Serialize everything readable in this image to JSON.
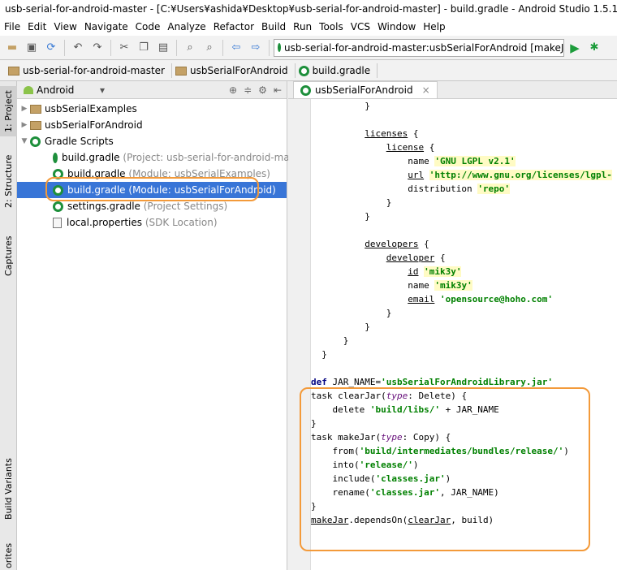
{
  "window": {
    "title": "usb-serial-for-android-master - [C:¥Users¥ashida¥Desktop¥usb-serial-for-android-master] - build.gradle - Android Studio 1.5.1"
  },
  "menu": [
    "File",
    "Edit",
    "View",
    "Navigate",
    "Code",
    "Analyze",
    "Refactor",
    "Build",
    "Run",
    "Tools",
    "VCS",
    "Window",
    "Help"
  ],
  "toolbar": {
    "run_config": "usb-serial-for-android-master:usbSerialForAndroid [makeJar]"
  },
  "breadcrumbs": [
    "usb-serial-for-android-master",
    "usbSerialForAndroid",
    "build.gradle"
  ],
  "side_tabs": [
    "1: Project",
    "2: Structure",
    "Captures",
    "Build Variants",
    "orites"
  ],
  "project": {
    "view": "Android",
    "items": [
      {
        "name": "usbSerialExamples",
        "note": ""
      },
      {
        "name": "usbSerialForAndroid",
        "note": ""
      },
      {
        "name": "Gradle Scripts",
        "note": ""
      },
      {
        "name": "build.gradle",
        "note": "(Project: usb-serial-for-android-master"
      },
      {
        "name": "build.gradle",
        "note": "(Module: usbSerialExamples)"
      },
      {
        "name": "build.gradle",
        "note": "(Module: usbSerialForAndroid)"
      },
      {
        "name": "settings.gradle",
        "note": "(Project Settings)"
      },
      {
        "name": "local.properties",
        "note": "(SDK Location)"
      }
    ]
  },
  "editor": {
    "tab": "usbSerialForAndroid"
  },
  "colors": {
    "highlight": "#f39a3a",
    "selection": "#3875d7"
  }
}
